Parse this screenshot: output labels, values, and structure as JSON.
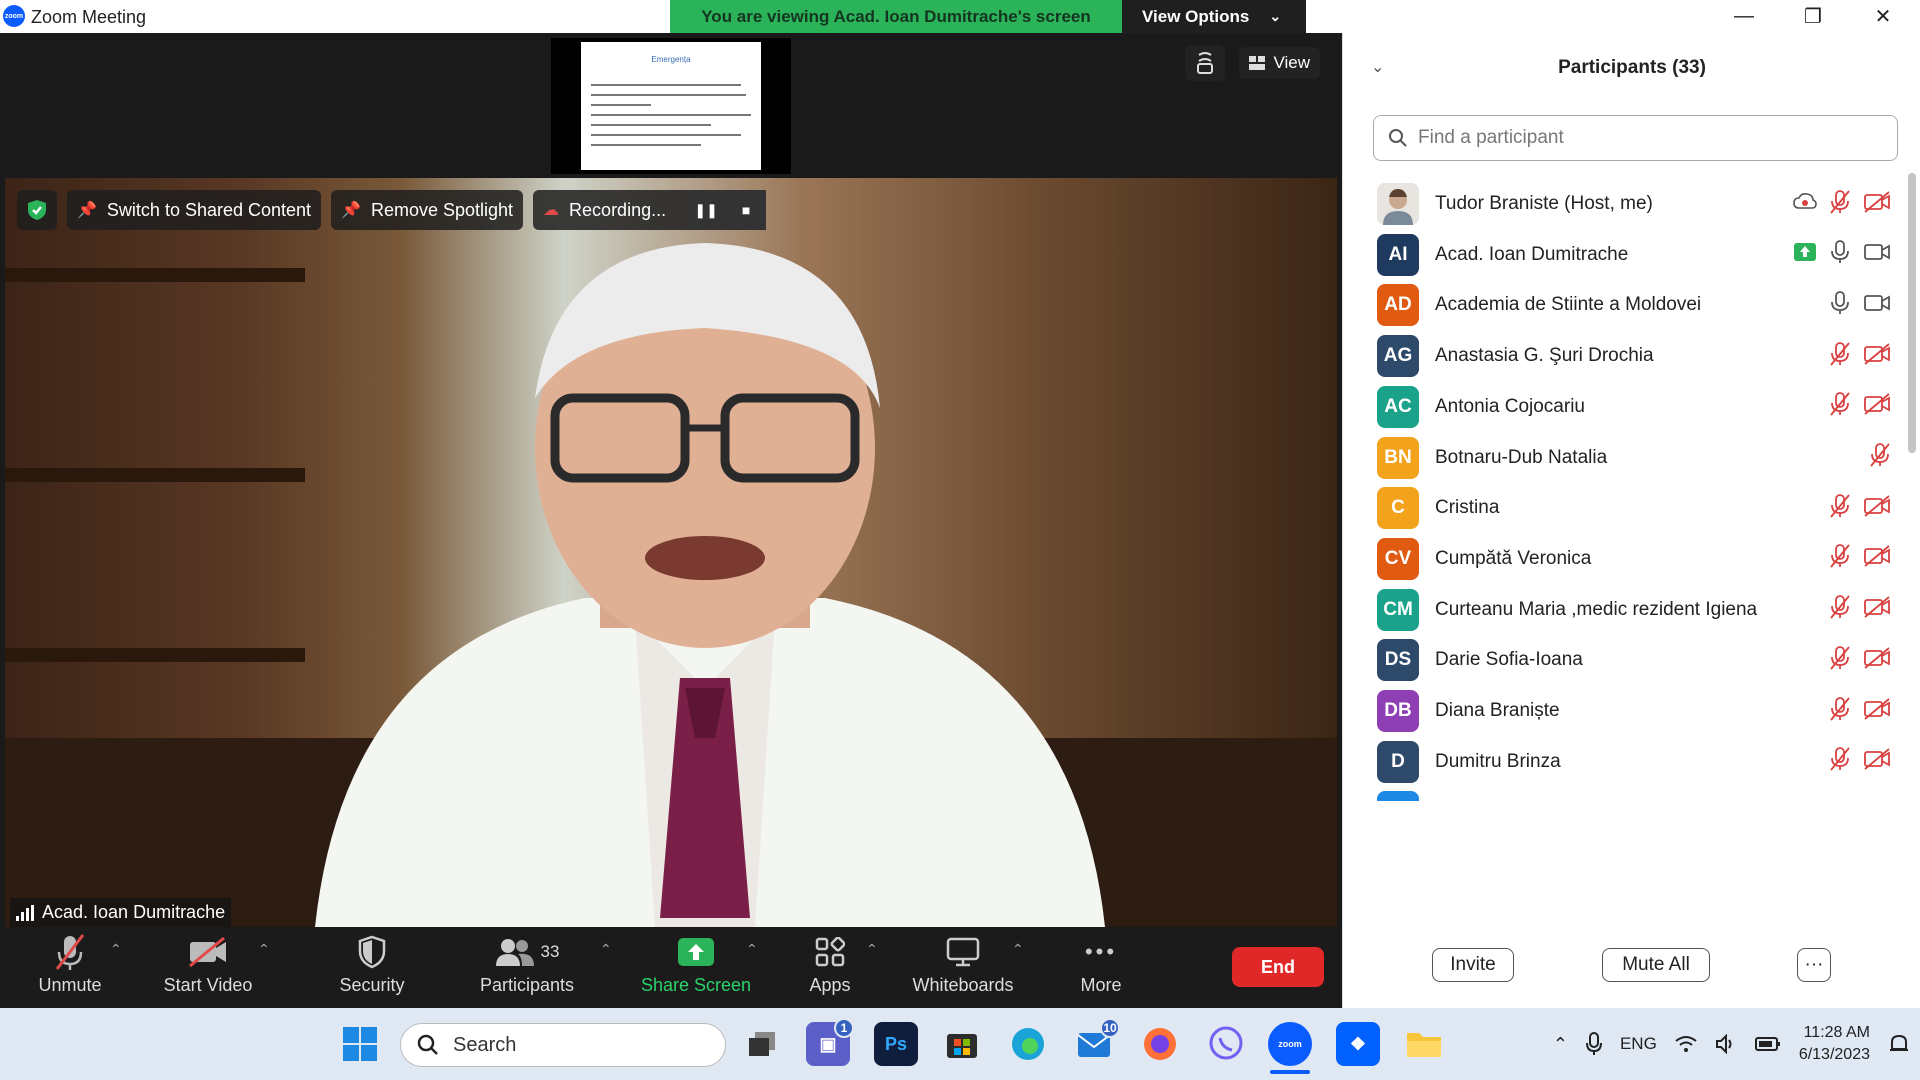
{
  "window": {
    "logo_text": "zoom",
    "title": "Zoom Meeting",
    "banner_message": "You are viewing Acad. Ioan Dumitrache's screen",
    "view_options_label": "View Options",
    "controls": {
      "minimize": "—",
      "maximize": "❐",
      "close": "✕"
    }
  },
  "shared_thumbnail": {
    "title": "Emergența"
  },
  "view_buttons": {
    "view_label": "View"
  },
  "video_overlay": {
    "switch_label": "Switch to Shared Content",
    "spotlight_label": "Remove Spotlight",
    "recording_label": "Recording...",
    "speaker_name": "Acad. Ioan Dumitrache"
  },
  "toolbar": {
    "unmute": "Unmute",
    "start_video": "Start Video",
    "security": "Security",
    "participants": "Participants",
    "participants_count": "33",
    "share_screen": "Share Screen",
    "apps": "Apps",
    "whiteboards": "Whiteboards",
    "more": "More",
    "end": "End"
  },
  "panel": {
    "title": "Participants (33)",
    "search_placeholder": "Find a participant",
    "invite": "Invite",
    "mute_all": "Mute All",
    "more": "···",
    "participants": [
      {
        "initials": "",
        "name": "Tudor Braniste (Host, me)",
        "color": "#c9a890",
        "photo": true,
        "icons": [
          "record",
          "mic-off",
          "video-off"
        ]
      },
      {
        "initials": "AI",
        "name": "Acad. Ioan Dumitrache",
        "color": "#1f3a5f",
        "icons": [
          "share",
          "mic",
          "video"
        ]
      },
      {
        "initials": "AD",
        "name": "Academia de Stiinte a Moldovei",
        "color": "#e05a12",
        "icons": [
          "mic",
          "video"
        ]
      },
      {
        "initials": "AG",
        "name": "Anastasia G. Şuri Drochia",
        "color": "#2e4a6b",
        "icons": [
          "mic-off",
          "video-off"
        ]
      },
      {
        "initials": "AC",
        "name": "Antonia Cojocariu",
        "color": "#1aa38a",
        "icons": [
          "mic-off",
          "video-off"
        ]
      },
      {
        "initials": "BN",
        "name": "Botnaru-Dub Natalia",
        "color": "#f2a21b",
        "icons": [
          "mic-off"
        ]
      },
      {
        "initials": "C",
        "name": "Cristina",
        "color": "#f2a21b",
        "icons": [
          "mic-off",
          "video-off"
        ]
      },
      {
        "initials": "CV",
        "name": "Cumpătă Veronica",
        "color": "#e05a12",
        "icons": [
          "mic-off",
          "video-off"
        ]
      },
      {
        "initials": "CM",
        "name": "Curteanu Maria ,medic rezident Igiena",
        "color": "#1aa38a",
        "icons": [
          "mic-off",
          "video-off"
        ]
      },
      {
        "initials": "DS",
        "name": "Darie Sofia-Ioana",
        "color": "#2e4a6b",
        "icons": [
          "mic-off",
          "video-off"
        ]
      },
      {
        "initials": "DB",
        "name": "Diana Braniște",
        "color": "#8e3fb3",
        "icons": [
          "mic-off",
          "video-off"
        ]
      },
      {
        "initials": "D",
        "name": "Dumitru Brinza",
        "color": "#2e4a6b",
        "icons": [
          "mic-off",
          "video-off"
        ]
      }
    ]
  },
  "taskbar": {
    "search_label": "Search",
    "teams_badge": "1",
    "mail_badge": "10",
    "language": "ENG",
    "time": "11:28 AM",
    "date": "6/13/2023"
  },
  "colors": {
    "accent_green": "#2bb35a",
    "end_red": "#e02828",
    "mute_red": "#d94040"
  }
}
